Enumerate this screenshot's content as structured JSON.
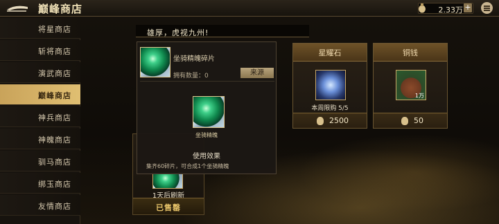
{
  "header": {
    "title": "巅峰商店",
    "currency_value": "2.33万",
    "plus_label": "+"
  },
  "sidebar": {
    "items": [
      {
        "label": "将星商店"
      },
      {
        "label": "斩将商店"
      },
      {
        "label": "演武商店"
      },
      {
        "label": "巅峰商店",
        "active": true
      },
      {
        "label": "神兵商店"
      },
      {
        "label": "神魄商店"
      },
      {
        "label": "驯马商店"
      },
      {
        "label": "绑玉商店"
      },
      {
        "label": "友情商店"
      }
    ]
  },
  "message": "雄厚，虎视九州!",
  "popup": {
    "item_name": "坐骑精魄碎片",
    "count_label": "拥有数量：0",
    "source_button": "来源",
    "big_item_label": "坐骑精魄",
    "effect_title": "使用效果",
    "effect_desc": "集齐60碎片，可合成1个坐骑精魄"
  },
  "cards": [
    {
      "title": "星耀石",
      "sub": "本周限购 5/5",
      "price": "2500",
      "icon": "star-stone-icon"
    },
    {
      "title": "铜钱",
      "sub": "1万",
      "price": "50",
      "icon": "copper-coins-icon"
    }
  ],
  "left_card": {
    "refresh_label": "1天后刷新",
    "status_label": "已售罄"
  },
  "colors": {
    "accent_gold": "#e0bf72",
    "active_tab": "#c9a35a"
  }
}
